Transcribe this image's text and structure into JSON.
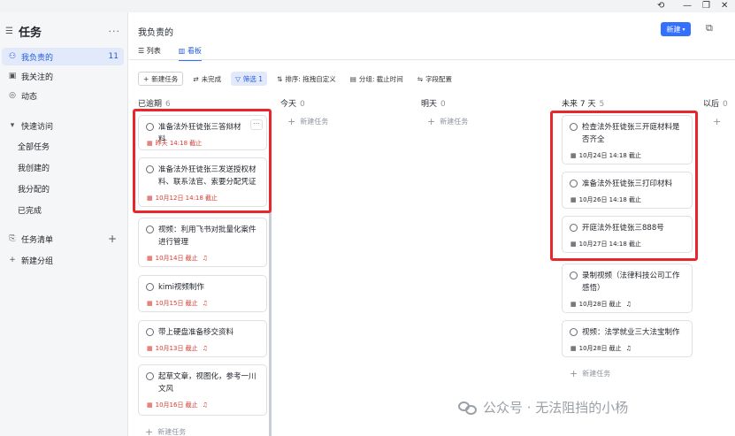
{
  "window": {
    "history_icon": "history-icon",
    "controls": [
      "minimize",
      "restore",
      "close"
    ]
  },
  "sidebar": {
    "title": "任务",
    "items": [
      {
        "label": "我负责的",
        "count": "11",
        "icon": "person-icon",
        "active": true
      },
      {
        "label": "我关注的",
        "icon": "watch-icon"
      },
      {
        "label": "动态",
        "icon": "activity-icon"
      }
    ],
    "quick_access": {
      "label": "快速访问",
      "items": [
        "全部任务",
        "我创建的",
        "我分配的",
        "已完成"
      ]
    },
    "task_list": {
      "label": "任务清单"
    },
    "new_group": "新建分组"
  },
  "header": {
    "title": "我负责的",
    "new_button": "新建",
    "tabs": [
      {
        "label": "列表",
        "active": false
      },
      {
        "label": "看板",
        "active": true
      }
    ]
  },
  "toolbar": {
    "new_task": "新建任务",
    "incomplete": "未完成",
    "filter": "筛选 1",
    "sort": "排序: 拖拽自定义",
    "group": "分组: 截止时间",
    "fields": "字段配置"
  },
  "columns": [
    {
      "title": "已逾期",
      "count": "6"
    },
    {
      "title": "今天",
      "count": "0"
    },
    {
      "title": "明天",
      "count": "0"
    },
    {
      "title": "未来 7 天",
      "count": "5"
    },
    {
      "title": "以后",
      "count": "0"
    }
  ],
  "overdue_cards": [
    {
      "title": "准备法外狂徒张三答辩材料",
      "due": "昨天 14:18 截止"
    },
    {
      "title": "准备法外狂徒张三发送授权材料、联系法官、索要分配凭证",
      "due": "10月12日 14:18 截止"
    },
    {
      "title": "视频：利用飞书对批量化案件进行管理",
      "due": "10月14日 截止"
    },
    {
      "title": "kimi视频制作",
      "due": "10月15日 截止"
    },
    {
      "title": "带上硬盘准备移交资料",
      "due": "10月13日 截止"
    },
    {
      "title": "起草文章，视图化，参考一川文风",
      "due": "10月16日 截止"
    }
  ],
  "future_cards": [
    {
      "title": "检查法外狂徒张三开庭材料是否齐全",
      "due": "10月24日 14:18 截止"
    },
    {
      "title": "准备法外狂徒张三打印材料",
      "due": "10月26日 14:18 截止"
    },
    {
      "title": "开庭法外狂徒张三888号",
      "due": "10月27日 14:18 截止"
    },
    {
      "title": "录制视频（法律科技公司工作感悟）",
      "due": "10月28日 截止"
    },
    {
      "title": "视频：法学就业三大法宝制作",
      "due": "10月28日 截止"
    }
  ],
  "new_task_label": "新建任务",
  "watermark": "公众号 · 无法阻挡的小杨",
  "colors": {
    "accent": "#3370ff",
    "overdue": "#d83931",
    "annotation": "#e8262c"
  }
}
